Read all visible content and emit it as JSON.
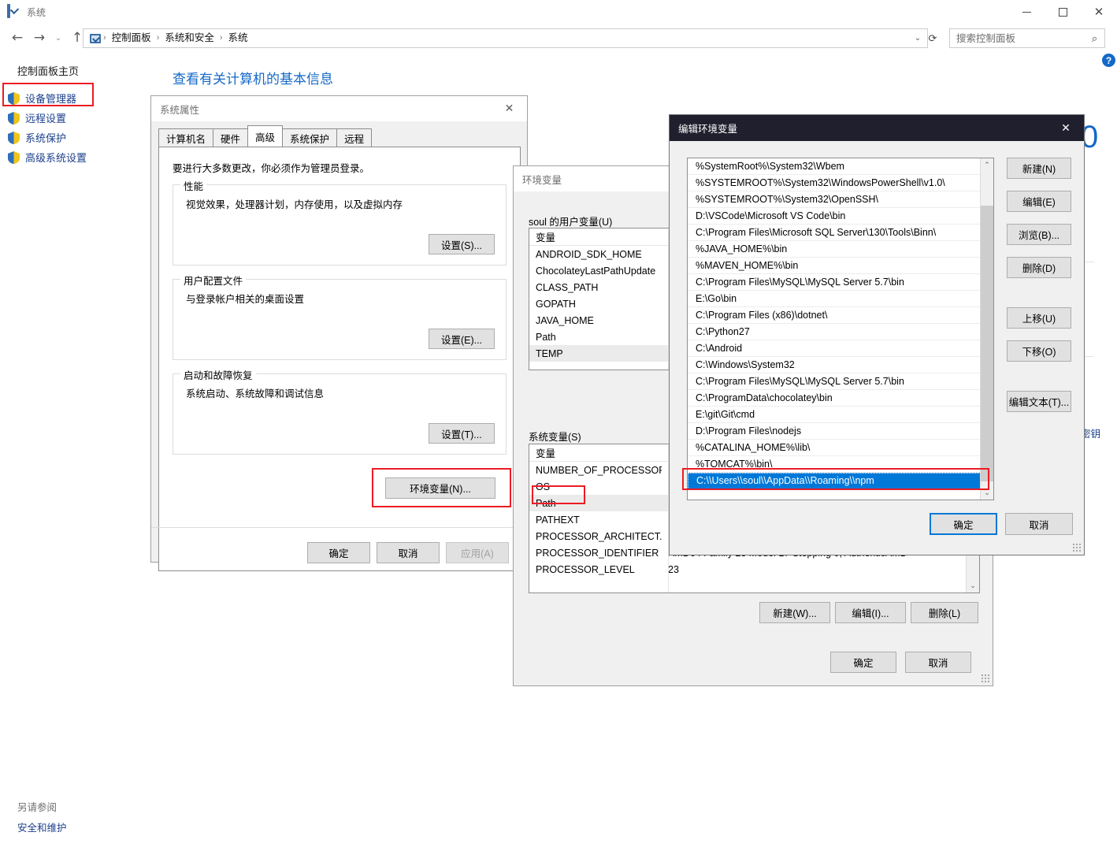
{
  "window": {
    "title": "系统",
    "title_icon": "monitor-icon",
    "controls": {
      "minimize": "minimize-icon",
      "maximize": "maximize-icon",
      "close": "close-icon"
    }
  },
  "nav": {
    "back": "back-arrow-icon",
    "forward": "forward-arrow-icon",
    "recent": "chevron-down-icon",
    "up": "up-arrow-icon",
    "breadcrumb": [
      "控制面板",
      "系统和安全",
      "系统"
    ],
    "separator": "›",
    "dropdown": "chevron-down-icon",
    "refresh": "refresh-icon"
  },
  "search": {
    "placeholder": "搜索控制面板",
    "icon": "search-icon"
  },
  "help": {
    "label": "?"
  },
  "sidebar": {
    "home": "控制面板主页",
    "items": [
      {
        "label": "设备管理器",
        "icon": "shield-icon"
      },
      {
        "label": "远程设置",
        "icon": "shield-icon"
      },
      {
        "label": "系统保护",
        "icon": "shield-icon"
      },
      {
        "label": "高级系统设置",
        "icon": "shield-icon",
        "highlighted": true
      }
    ],
    "see_also_label": "另请参阅",
    "see_also_link": "安全和维护"
  },
  "main": {
    "title": "查看有关计算机的基本信息",
    "edition_fragment": "0",
    "key_link_fragment": "密钥"
  },
  "system_properties": {
    "title": "系统属性",
    "close_icon": "close-icon",
    "tabs": [
      {
        "label": "计算机名",
        "active": false
      },
      {
        "label": "硬件",
        "active": false
      },
      {
        "label": "高级",
        "active": true
      },
      {
        "label": "系统保护",
        "active": false
      },
      {
        "label": "远程",
        "active": false
      }
    ],
    "note": "要进行大多数更改，你必须作为管理员登录。",
    "groups": [
      {
        "legend": "性能",
        "text": "视觉效果，处理器计划，内存使用，以及虚拟内存",
        "button": "设置(S)..."
      },
      {
        "legend": "用户配置文件",
        "text": "与登录帐户相关的桌面设置",
        "button": "设置(E)..."
      },
      {
        "legend": "启动和故障恢复",
        "text": "系统启动、系统故障和调试信息",
        "button": "设置(T)..."
      }
    ],
    "env_button": "环境变量(N)...",
    "ok": "确定",
    "cancel": "取消",
    "apply": "应用(A)"
  },
  "environment_variables": {
    "title": "环境变量",
    "user_group_label": "soul 的用户变量(U)",
    "column_variable": "变量",
    "user_variables": [
      "ANDROID_SDK_HOME",
      "ChocolateyLastPathUpdate",
      "CLASS_PATH",
      "GOPATH",
      "JAVA_HOME",
      "Path",
      "TEMP"
    ],
    "system_group_label": "系统变量(S)",
    "system_variables": [
      {
        "name": "NUMBER_OF_PROCESSORS",
        "value": ""
      },
      {
        "name": "OS",
        "value": ""
      },
      {
        "name": "Path",
        "value": "",
        "highlighted": true
      },
      {
        "name": "PATHEXT",
        "value": ""
      },
      {
        "name": "PROCESSOR_ARCHITECT...",
        "value": ""
      },
      {
        "name": "PROCESSOR_IDENTIFIER",
        "value": "AMD64 Family 23 Model 17 Stepping 0, AuthenticAMD"
      },
      {
        "name": "PROCESSOR_LEVEL",
        "value": "23"
      }
    ],
    "sys_buttons": [
      "新建(W)...",
      "编辑(I)...",
      "删除(L)"
    ],
    "ok": "确定",
    "cancel": "取消"
  },
  "edit_environment_variable": {
    "title": "编辑环境变量",
    "close_icon": "close-icon",
    "paths": [
      {
        "text": "%SystemRoot%\\System32\\Wbem",
        "selected": false
      },
      {
        "text": "%SYSTEMROOT%\\System32\\WindowsPowerShell\\v1.0\\",
        "selected": false
      },
      {
        "text": "%SYSTEMROOT%\\System32\\OpenSSH\\",
        "selected": false
      },
      {
        "text": "D:\\VSCode\\Microsoft VS Code\\bin",
        "selected": false
      },
      {
        "text": "C:\\Program Files\\Microsoft SQL Server\\130\\Tools\\Binn\\",
        "selected": false
      },
      {
        "text": "%JAVA_HOME%\\bin",
        "selected": false
      },
      {
        "text": "%MAVEN_HOME%\\bin",
        "selected": false
      },
      {
        "text": "C:\\Program Files\\MySQL\\MySQL Server 5.7\\bin",
        "selected": false
      },
      {
        "text": "E:\\Go\\bin",
        "selected": false
      },
      {
        "text": "C:\\Program Files (x86)\\dotnet\\",
        "selected": false
      },
      {
        "text": "C:\\Python27",
        "selected": false
      },
      {
        "text": "C:\\Android",
        "selected": false
      },
      {
        "text": "C:\\Windows\\System32",
        "selected": false
      },
      {
        "text": "C:\\Program Files\\MySQL\\MySQL Server 5.7\\bin",
        "selected": false
      },
      {
        "text": "C:\\ProgramData\\chocolatey\\bin",
        "selected": false
      },
      {
        "text": "E:\\git\\Git\\cmd",
        "selected": false
      },
      {
        "text": "D:\\Program Files\\nodejs",
        "selected": false
      },
      {
        "text": "%CATALINA_HOME%\\lib\\",
        "selected": false
      },
      {
        "text": "%TOMCAT%\\bin\\",
        "selected": false
      },
      {
        "text": "C:\\\\Users\\\\soul\\\\AppData\\\\Roaming\\\\npm",
        "selected": true
      }
    ],
    "buttons_group1": [
      "新建(N)",
      "编辑(E)",
      "浏览(B)...",
      "删除(D)"
    ],
    "buttons_group2": [
      "上移(U)",
      "下移(O)"
    ],
    "buttons_group3": [
      "编辑文本(T)..."
    ],
    "ok": "确定",
    "cancel": "取消",
    "scroll_up_icon": "chevron-up-icon",
    "scroll_down_icon": "chevron-down-icon"
  },
  "colors": {
    "accent": "#0078d7",
    "link": "#1b3f8b",
    "title_link": "#1569c7",
    "highlight_red": "#ec1c24",
    "dialog_bg": "#f0f0f0"
  }
}
